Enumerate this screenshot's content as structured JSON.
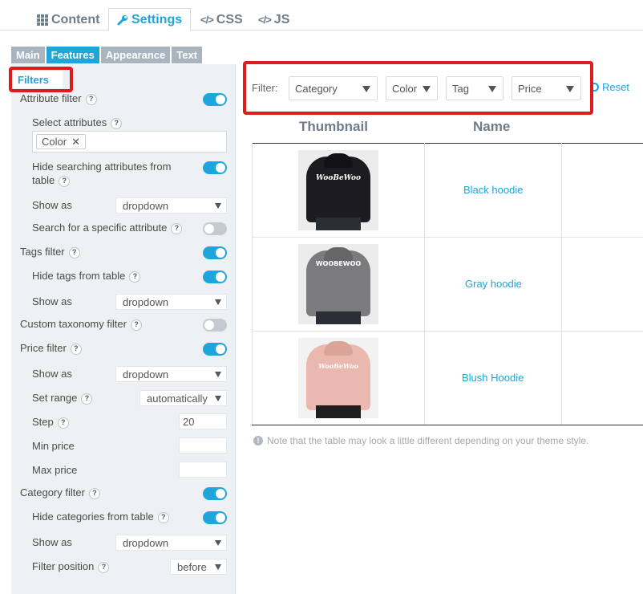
{
  "top_tabs": {
    "content": "Content",
    "settings": "Settings",
    "css": "CSS",
    "js": "JS",
    "code_glyph": "</>"
  },
  "sub_tabs": [
    "Main",
    "Features",
    "Appearance",
    "Text"
  ],
  "section_title": "Filters",
  "help_glyph": "?",
  "settings": {
    "attribute_filter": "Attribute filter",
    "select_attributes": "Select attributes",
    "attribute_chip": "Color",
    "chip_remove": "✕",
    "hide_searching_attributes_1": "Hide searching attributes from",
    "hide_searching_attributes_2": "table",
    "show_as": "Show as",
    "dropdown": "dropdown",
    "search_specific_attribute": "Search for a specific attribute",
    "tags_filter": "Tags filter",
    "hide_tags": "Hide tags from table",
    "custom_taxonomy_filter": "Custom taxonomy filter",
    "price_filter": "Price filter",
    "set_range": "Set range",
    "set_range_value": "automatically",
    "step": "Step",
    "step_value": "20",
    "min_price": "Min price",
    "max_price": "Max price",
    "category_filter": "Category filter",
    "hide_categories": "Hide categories from table",
    "filter_position": "Filter position",
    "filter_position_value": "before"
  },
  "toggles": {
    "attribute_filter": true,
    "hide_searching_attributes": true,
    "search_specific_attribute": false,
    "tags_filter": true,
    "hide_tags": true,
    "custom_taxonomy_filter": false,
    "price_filter": true,
    "category_filter": true,
    "hide_categories": true
  },
  "filter_bar": {
    "label": "Filter:",
    "selects": [
      "Category",
      "Color",
      "Tag",
      "Price"
    ],
    "reset": "Reset"
  },
  "table": {
    "headers": [
      "Thumbnail",
      "Name"
    ],
    "rows": [
      {
        "name": "Black hoodie",
        "brand": "WooBeWoo"
      },
      {
        "name": "Gray hoodie",
        "brand": "WOOBEWOO"
      },
      {
        "name": "Blush Hoodie",
        "brand": "WooBeWoo"
      }
    ]
  },
  "note": {
    "icon": "!",
    "text": "Note that the table may look a little different depending on your theme style."
  },
  "colors": {
    "accent": "#1ea5dc",
    "highlight": "#e01b1b",
    "toggle_off": "#c3cad1",
    "hoodie_black": "#1c1c20",
    "hoodie_gray": "#7b7b7d",
    "hoodie_blush": "#eab8ae"
  }
}
